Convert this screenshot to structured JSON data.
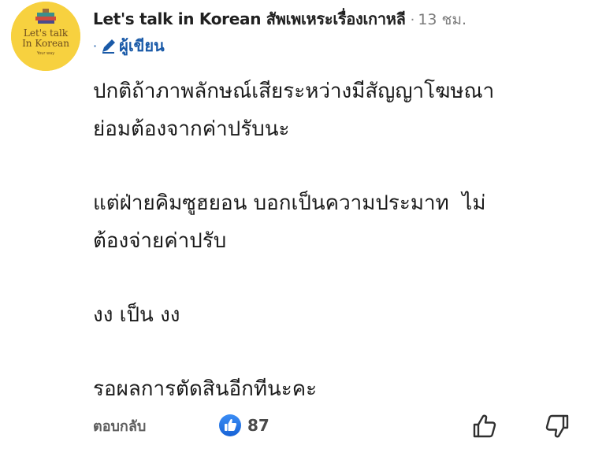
{
  "author": {
    "name": "Let's talk in Korean สัพเพเหระเรื่องเกาหลี",
    "time": "13 ชม.",
    "separator": "·",
    "badge_dot": "·",
    "badge_label": "ผู้เขียน",
    "avatar_text_line1": "Let's talk",
    "avatar_text_line2": "In Korean",
    "avatar_text_line3": "Your way",
    "avatar_color": "#f7d13f"
  },
  "comment": {
    "paragraphs": [
      [
        "ปกติถ้าภาพลักษณ์เสียระหว่างมีสัญญาโฆษณา",
        "ย่อมต้องจากค่าปรับนะ"
      ],
      [
        "แต่ฝ่ายคิมซูฮยอน บอกเป็นความประมาท  ไม่",
        "ต้องจ่ายค่าปรับ"
      ],
      [
        "งง เป็น งง"
      ],
      [
        "รอผลการตัดสินอีกทีนะคะ"
      ]
    ]
  },
  "actions": {
    "reply_label": "ตอบกลับ",
    "like_count": "87",
    "like_icon": "thumbs-up-badge-icon",
    "like_button_icon": "thumbs-up-icon",
    "dislike_button_icon": "thumbs-down-icon",
    "accent_color": "#1877f2"
  }
}
